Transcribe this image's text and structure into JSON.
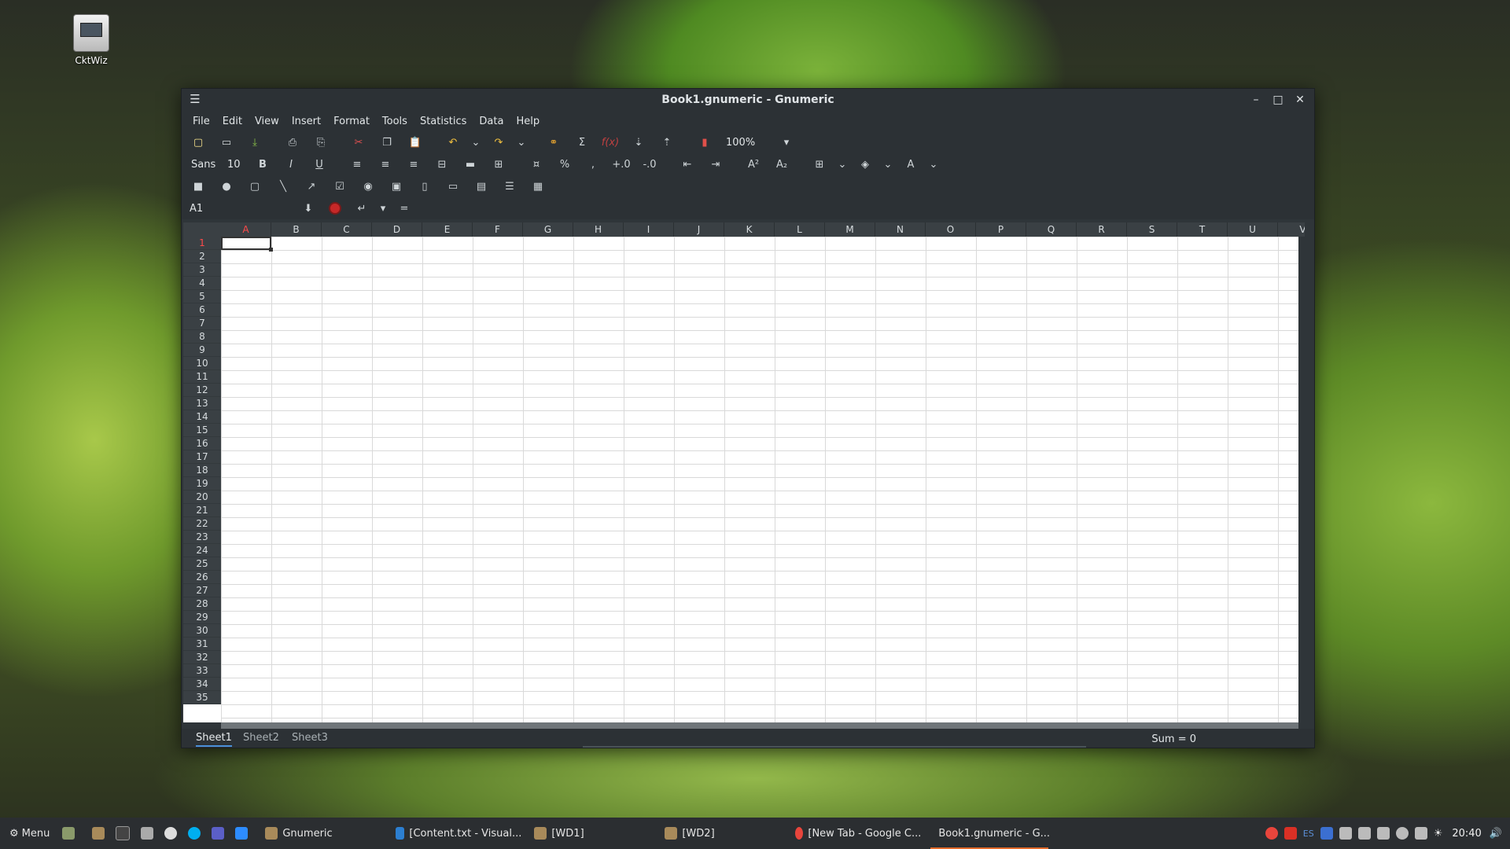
{
  "desktop": {
    "icon_label": "CktWiz"
  },
  "window": {
    "title": "Book1.gnumeric - Gnumeric",
    "menu": [
      "File",
      "Edit",
      "View",
      "Insert",
      "Format",
      "Tools",
      "Statistics",
      "Data",
      "Help"
    ],
    "zoom": "100%",
    "font_name": "Sans",
    "font_size": "10",
    "cell_ref": "A1",
    "columns": [
      "A",
      "B",
      "C",
      "D",
      "E",
      "F",
      "G",
      "H",
      "I",
      "J",
      "K",
      "L",
      "M",
      "N",
      "O",
      "P",
      "Q",
      "R",
      "S",
      "T",
      "U",
      "V"
    ],
    "rows": [
      "1",
      "2",
      "3",
      "4",
      "5",
      "6",
      "7",
      "8",
      "9",
      "10",
      "11",
      "12",
      "13",
      "14",
      "15",
      "16",
      "17",
      "18",
      "19",
      "20",
      "21",
      "22",
      "23",
      "24",
      "25",
      "26",
      "27",
      "28",
      "29",
      "30",
      "31",
      "32",
      "33",
      "34",
      "35"
    ],
    "sheets": [
      "Sheet1",
      "Sheet2",
      "Sheet3"
    ],
    "status": "Sum = 0"
  },
  "taskbar": {
    "menu_label": "Menu",
    "items": [
      "Gnumeric",
      "[Content.txt - Visual...",
      "[WD1]",
      "[WD2]",
      "[New Tab - Google C...",
      "Book1.gnumeric - G..."
    ],
    "tray_lang": "ES",
    "clock": "20:40"
  },
  "colors": {
    "accent": "#4a8fd9",
    "active_task": "#e36b2b",
    "cancel": "#c62828"
  }
}
